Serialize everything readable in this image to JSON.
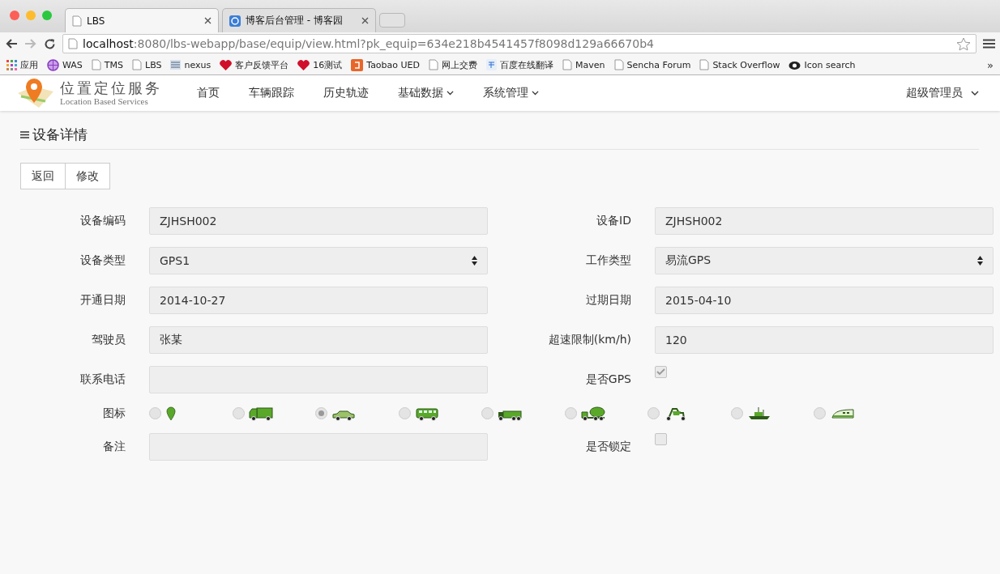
{
  "browser": {
    "tabs": [
      {
        "title": "LBS",
        "kind": "page",
        "selected": true
      },
      {
        "title": "博客后台管理 - 博客园",
        "kind": "blog",
        "selected": false
      }
    ],
    "url": {
      "host": "localhost",
      "rest": ":8080/lbs-webapp/base/equip/view.html?pk_equip=634e218b4541457f8098d129a66670b4"
    },
    "bookmarks": [
      {
        "label": "应用",
        "kind": "apps"
      },
      {
        "label": "WAS",
        "kind": "globe"
      },
      {
        "label": "TMS",
        "kind": "page"
      },
      {
        "label": "LBS",
        "kind": "page"
      },
      {
        "label": "nexus",
        "kind": "bars"
      },
      {
        "label": "客户反馈平台",
        "kind": "heart"
      },
      {
        "label": "16测试",
        "kind": "heart"
      },
      {
        "label": "Taobao UED",
        "kind": "badge"
      },
      {
        "label": "网上交费",
        "kind": "page"
      },
      {
        "label": "百度在线翻译",
        "kind": "translate"
      },
      {
        "label": "Maven",
        "kind": "page"
      },
      {
        "label": "Sencha Forum",
        "kind": "page"
      },
      {
        "label": "Stack Overflow",
        "kind": "page"
      },
      {
        "label": "Icon search",
        "kind": "eye"
      }
    ],
    "more": "»"
  },
  "app": {
    "logo_title": "位置定位服务",
    "logo_subtitle": "Location Based Services",
    "nav": [
      {
        "label": "首页",
        "dropdown": false
      },
      {
        "label": "车辆跟踪",
        "dropdown": false
      },
      {
        "label": "历史轨迹",
        "dropdown": false
      },
      {
        "label": "基础数据",
        "dropdown": true
      },
      {
        "label": "系统管理",
        "dropdown": true
      }
    ],
    "user": "超级管理员"
  },
  "page": {
    "title": "设备详情",
    "buttons": [
      "返回",
      "修改"
    ],
    "rows": [
      [
        {
          "label": "设备编码",
          "kind": "text",
          "value": "ZJHSH002"
        },
        {
          "label": "设备ID",
          "kind": "text",
          "value": "ZJHSH002"
        }
      ],
      [
        {
          "label": "设备类型",
          "kind": "select",
          "value": "GPS1"
        },
        {
          "label": "工作类型",
          "kind": "select",
          "value": "易流GPS"
        }
      ],
      [
        {
          "label": "开通日期",
          "kind": "text",
          "value": "2014-10-27"
        },
        {
          "label": "过期日期",
          "kind": "text",
          "value": "2015-04-10"
        }
      ],
      [
        {
          "label": "驾驶员",
          "kind": "text",
          "value": "张某"
        },
        {
          "label": "超速限制(km/h)",
          "kind": "text",
          "value": "120"
        }
      ],
      [
        {
          "label": "联系电话",
          "kind": "text"
        },
        {
          "label": "是否GPS",
          "kind": "checkbox",
          "checked": true
        }
      ]
    ],
    "icon_label": "图标",
    "icons": [
      {
        "kind": "pin",
        "selected": false
      },
      {
        "kind": "truck",
        "selected": false
      },
      {
        "kind": "car",
        "selected": true
      },
      {
        "kind": "bus",
        "selected": false
      },
      {
        "kind": "trailer",
        "selected": false
      },
      {
        "kind": "mixer",
        "selected": false
      },
      {
        "kind": "motorcycle",
        "selected": false
      },
      {
        "kind": "ship",
        "selected": false
      },
      {
        "kind": "train",
        "selected": false
      }
    ],
    "last_row": [
      {
        "label": "备注",
        "kind": "text"
      },
      {
        "label": "是否锁定",
        "kind": "checkbox",
        "checked": false
      }
    ]
  }
}
